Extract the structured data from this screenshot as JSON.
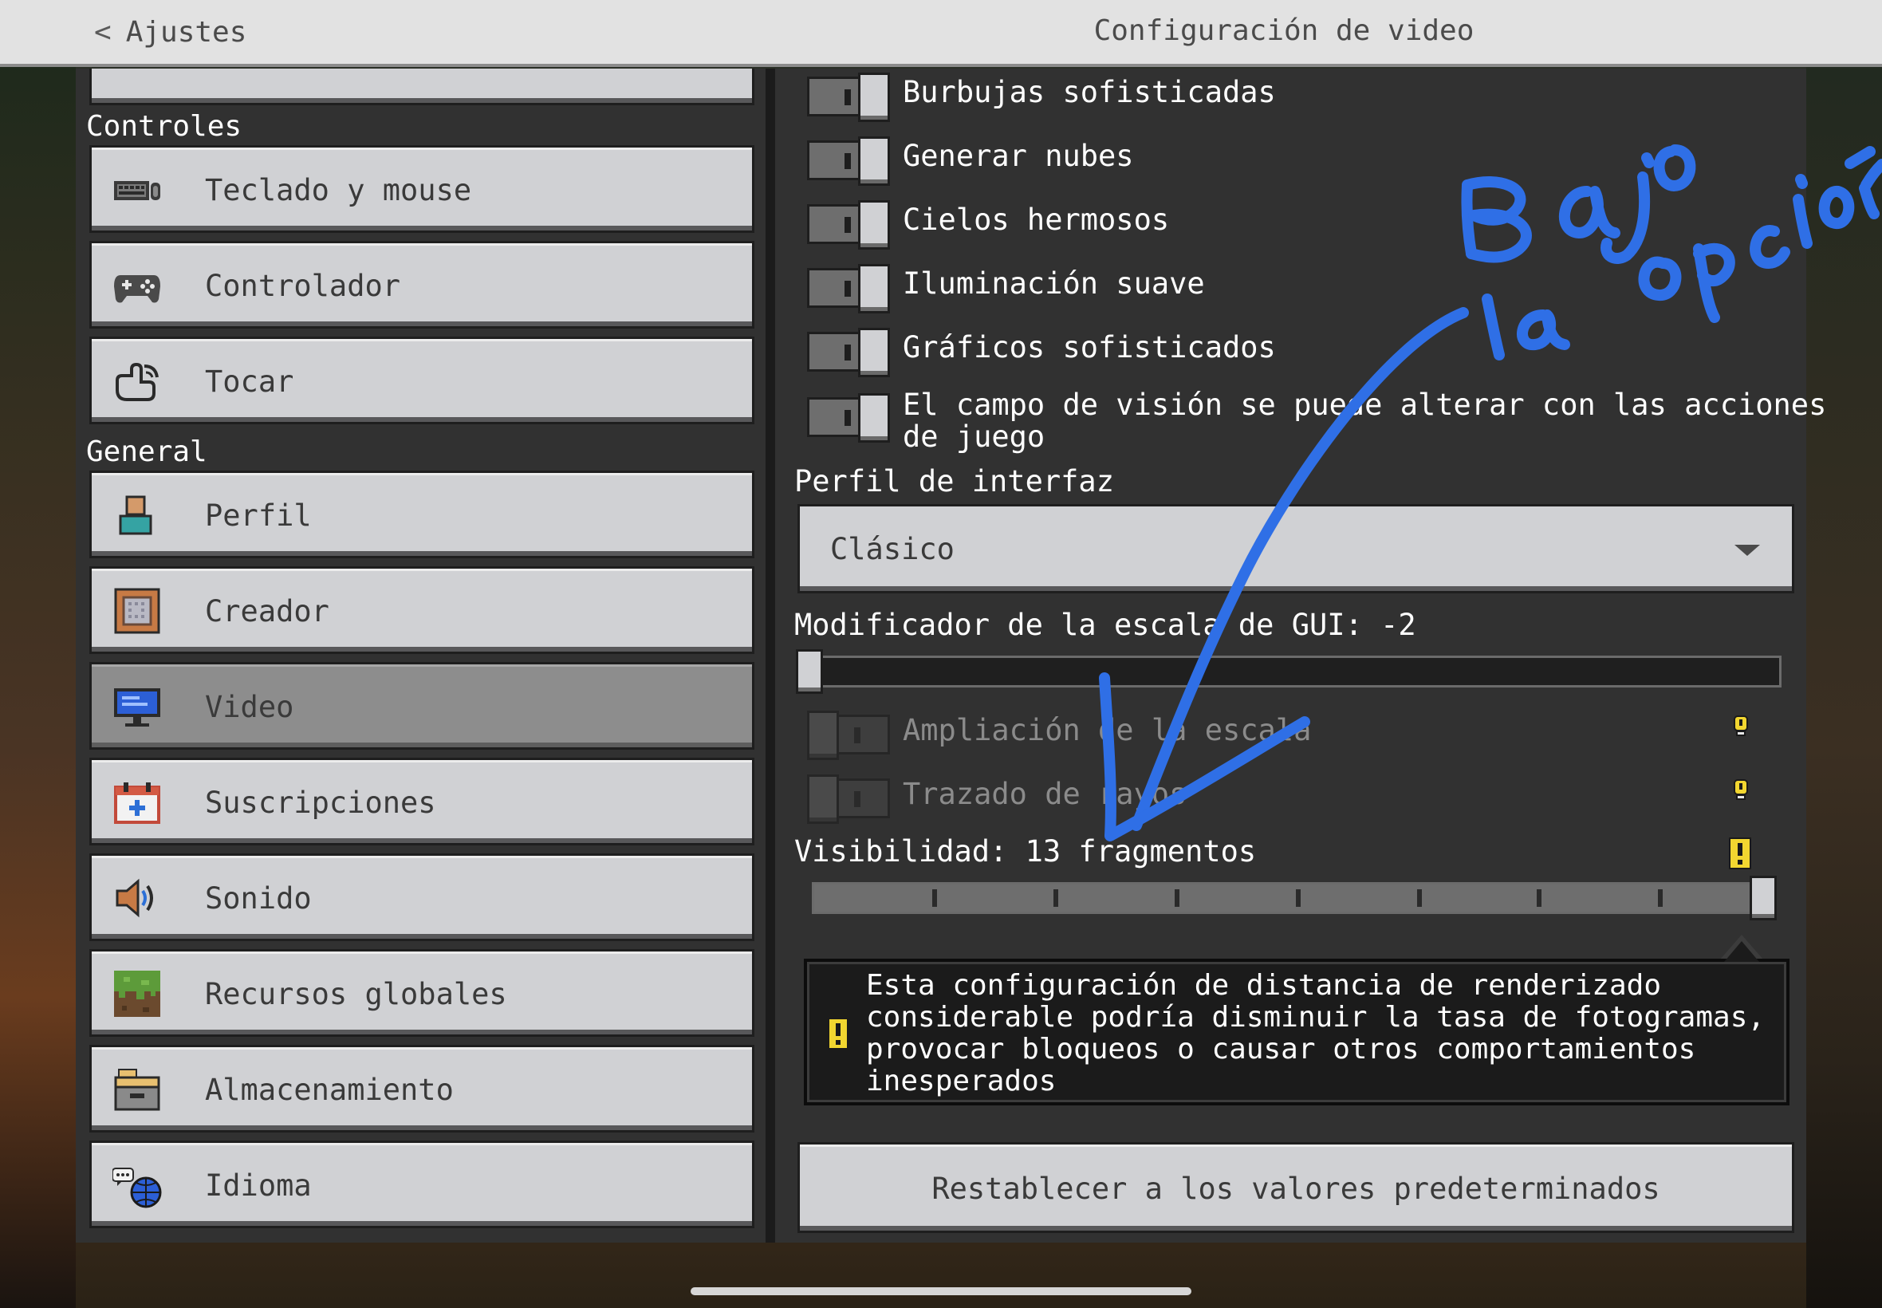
{
  "header": {
    "back_label": "Ajustes",
    "title": "Configuración de video"
  },
  "sidebar": {
    "sections": [
      {
        "label": "Controles"
      },
      {
        "label": "General"
      }
    ],
    "items": [
      {
        "label": "Teclado y mouse",
        "icon": "keyboard-mouse-icon"
      },
      {
        "label": "Controlador",
        "icon": "gamepad-icon"
      },
      {
        "label": "Tocar",
        "icon": "touch-hand-icon"
      },
      {
        "label": "Perfil",
        "icon": "profile-icon"
      },
      {
        "label": "Creador",
        "icon": "creator-icon"
      },
      {
        "label": "Video",
        "icon": "monitor-icon",
        "active": true
      },
      {
        "label": "Suscripciones",
        "icon": "subscriptions-icon"
      },
      {
        "label": "Sonido",
        "icon": "speaker-icon"
      },
      {
        "label": "Recursos globales",
        "icon": "grass-block-icon"
      },
      {
        "label": "Almacenamiento",
        "icon": "storage-box-icon"
      },
      {
        "label": "Idioma",
        "icon": "language-globe-icon"
      }
    ]
  },
  "settings": {
    "toggles": [
      {
        "label": "Burbujas sofisticadas",
        "on": true
      },
      {
        "label": "Generar nubes",
        "on": true
      },
      {
        "label": "Cielos hermosos",
        "on": true
      },
      {
        "label": "Iluminación suave",
        "on": true
      },
      {
        "label": "Gráficos sofisticados",
        "on": true
      },
      {
        "label_line1": "El campo de visión se puede alterar con las acciones",
        "label_line2": "de juego",
        "on": true
      }
    ],
    "interface_profile": {
      "label": "Perfil de interfaz",
      "value": "Clásico"
    },
    "gui_scale": {
      "label": "Modificador de la escala de GUI: -2",
      "level": 0
    },
    "disabled_toggles": [
      {
        "label": "Ampliación de la escala",
        "on": false
      },
      {
        "label": "Trazado de rayos",
        "on": false
      }
    ],
    "render_distance": {
      "label": "Visibilidad: 13 fragmentos",
      "level": 1.0
    },
    "warning_text": "Esta configuración de distancia de renderizado considerable podría disminuir la tasa de fotogramas, provocar bloqueos o causar otros comportamientos inesperados",
    "reset_label": "Restablecer a los valores predeterminados"
  },
  "handwriting": {
    "text": "Bajo la opción",
    "color": "#2f6fe6"
  },
  "colors": {
    "panel": "#313131",
    "button": "#d0d1d4",
    "active_button": "#8d8d8d",
    "warning_yellow": "#f2d630"
  }
}
